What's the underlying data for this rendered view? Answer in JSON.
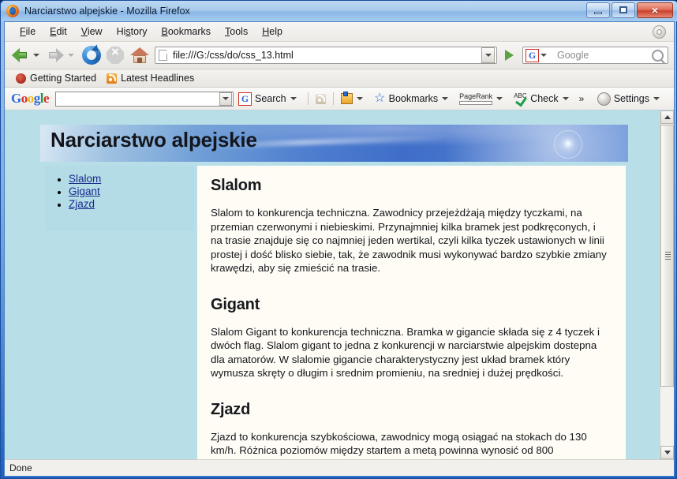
{
  "window": {
    "title": "Narciarstwo alpejskie - Mozilla Firefox",
    "app_icon": "firefox-icon",
    "controls": {
      "minimize": "minimize-button",
      "restore": "restore-button",
      "close_glyph": "×"
    }
  },
  "menubar": {
    "items": [
      {
        "label": "File",
        "accel": "F"
      },
      {
        "label": "Edit",
        "accel": "E"
      },
      {
        "label": "View",
        "accel": "V"
      },
      {
        "label": "History",
        "accel": "s"
      },
      {
        "label": "Bookmarks",
        "accel": "B"
      },
      {
        "label": "Tools",
        "accel": "T"
      },
      {
        "label": "Help",
        "accel": "H"
      }
    ]
  },
  "navbar": {
    "back": "Back",
    "forward": "Forward",
    "reload": "Reload",
    "stop": "Stop",
    "home": "Home",
    "url_value": "file:///G:/css/do/css_13.html",
    "go": "Go",
    "search_engine": "G",
    "search_placeholder": "Google"
  },
  "bookmarks_bar": {
    "items": [
      {
        "label": "Getting Started",
        "icon": "firefox-small-icon"
      },
      {
        "label": "Latest Headlines",
        "icon": "rss-icon"
      }
    ]
  },
  "google_toolbar": {
    "logo": [
      {
        "ch": "G",
        "cls": "b"
      },
      {
        "ch": "o",
        "cls": "r"
      },
      {
        "ch": "o",
        "cls": "y"
      },
      {
        "ch": "g",
        "cls": "b"
      },
      {
        "ch": "l",
        "cls": "g"
      },
      {
        "ch": "e",
        "cls": "r"
      }
    ],
    "search_value": "",
    "search_label": "Search",
    "bookmarks_label": "Bookmarks",
    "pagerank_label": "PageRank",
    "check_label": "Check",
    "check_badge": "ABC",
    "overflow": "»",
    "settings_label": "Settings"
  },
  "page": {
    "banner_title": "Narciarstwo alpejskie",
    "nav_links": [
      {
        "label": "Slalom"
      },
      {
        "label": "Gigant"
      },
      {
        "label": "Zjazd"
      }
    ],
    "sections": [
      {
        "heading": "Slalom",
        "body": "Slalom to konkurencja techniczna. Zawodnicy przejeżdżają między tyczkami, na przemian czerwonymi i niebieskimi. Przynajmniej kilka bramek jest podkręconych, i na trasie znajduje się co najmniej jeden wertikal, czyli kilka tyczek ustawionych w linii prostej i dość blisko siebie, tak, że zawodnik musi wykonywać bardzo szybkie zmiany krawędzi, aby się zmieścić na trasie."
      },
      {
        "heading": "Gigant",
        "body": "Slalom Gigant to konkurencja techniczna. Bramka w gigancie składa się z 4 tyczek i dwóch flag. Slalom gigant to jedna z konkurencji w narciarstwie alpejskim dostepna dla amatorów. W slalomie gigancie charakterystyczny jest układ bramek który wymusza skręty o długim i srednim promieniu, na sredniej i dużej prędkości."
      },
      {
        "heading": "Zjazd",
        "body": "Zjazd to konkurencja szybkościowa, zawodnicy mogą osiągać na stokach do 130 km/h. Różnica poziomów między startem a metą powinna wynosić od 800"
      }
    ]
  },
  "statusbar": {
    "text": "Done"
  },
  "colors": {
    "page_background": "#b8dfe8",
    "sidebar_background": "#b3dce6",
    "content_background": "#fefcf5",
    "link": "#1a2a8c",
    "banner_blue": "#4f7fcf",
    "titlebar_blue": "#8ab7e6"
  }
}
